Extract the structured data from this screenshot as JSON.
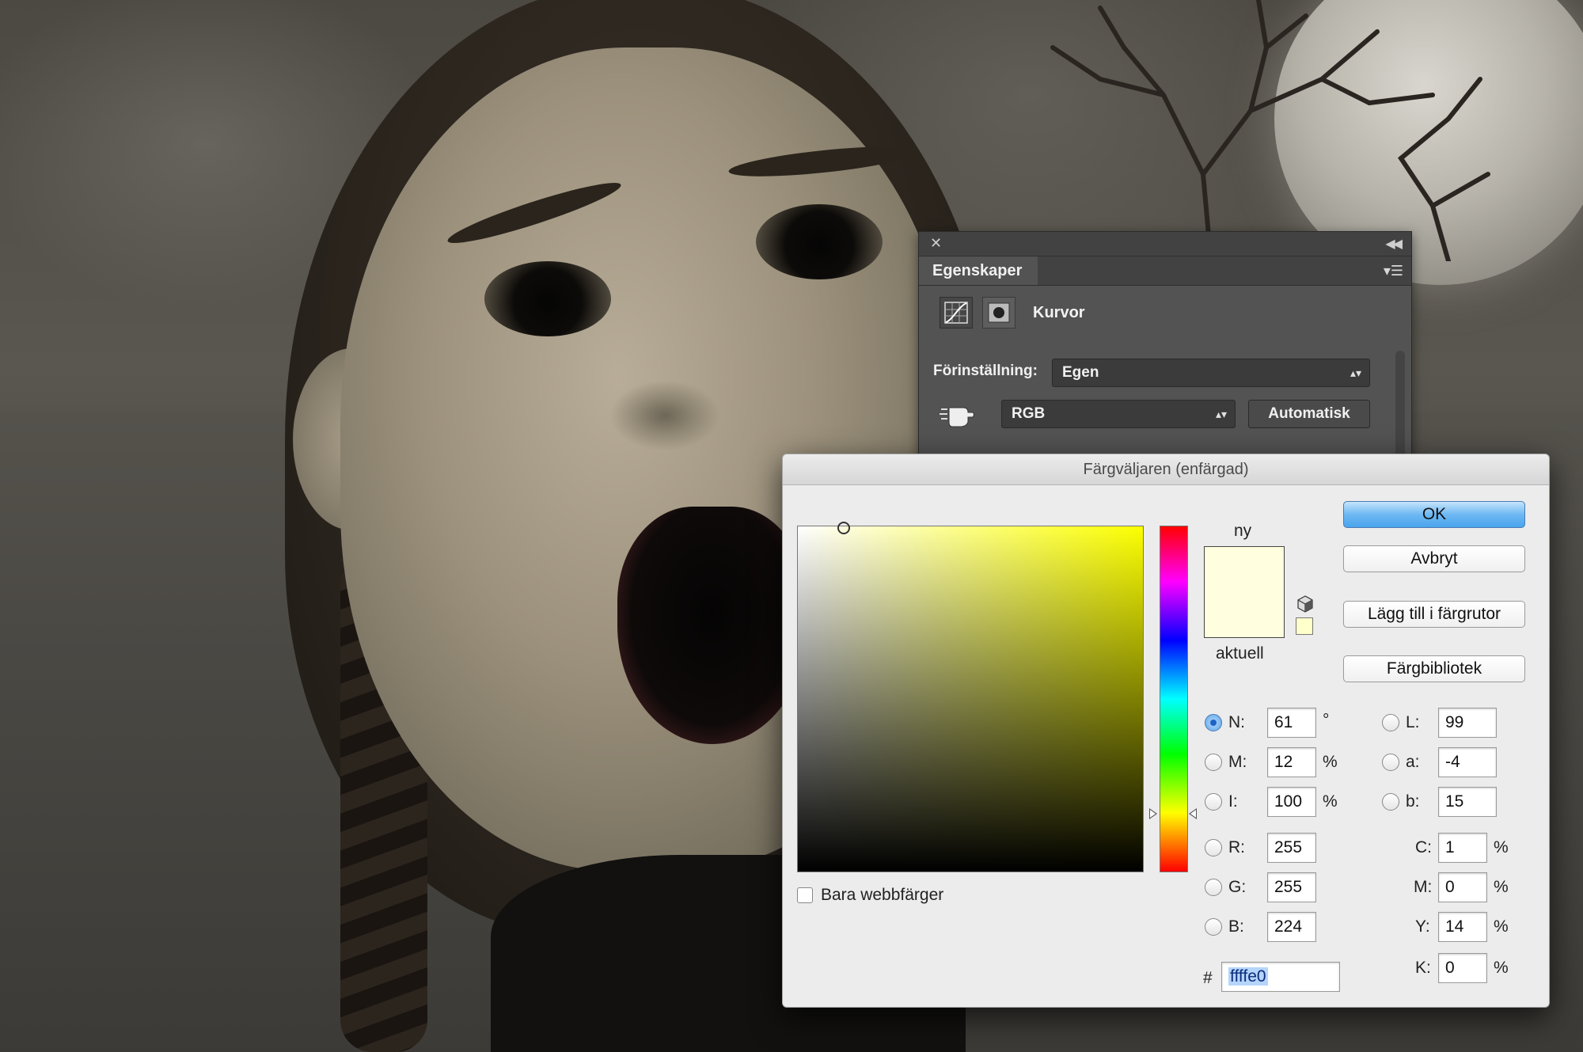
{
  "properties_panel": {
    "tab_label": "Egenskaper",
    "adjustment_title": "Kurvor",
    "preset_label": "Förinställning:",
    "preset_value": "Egen",
    "channel_value": "RGB",
    "auto_button": "Automatisk"
  },
  "color_picker": {
    "title": "Färgväljaren (enfärgad)",
    "buttons": {
      "ok": "OK",
      "cancel": "Avbryt",
      "add_swatches": "Lägg till i färgrutor",
      "color_libraries": "Färgbibliotek"
    },
    "new_label": "ny",
    "current_label": "aktuell",
    "web_only_label": "Bara webbfärger",
    "new_color": "#ffffe0",
    "current_color": "#ffffe0",
    "hsb": {
      "h": {
        "label": "N:",
        "value": "61",
        "unit": "°",
        "selected": true
      },
      "s": {
        "label": "M:",
        "value": "12",
        "unit": "%"
      },
      "b": {
        "label": "I:",
        "value": "100",
        "unit": "%"
      }
    },
    "rgb": {
      "r": {
        "label": "R:",
        "value": "255"
      },
      "g": {
        "label": "G:",
        "value": "255"
      },
      "b": {
        "label": "B:",
        "value": "224"
      }
    },
    "lab": {
      "l": {
        "label": "L:",
        "value": "99"
      },
      "a": {
        "label": "a:",
        "value": "-4"
      },
      "b": {
        "label": "b:",
        "value": "15"
      }
    },
    "cmyk": {
      "c": {
        "label": "C:",
        "value": "1",
        "unit": "%"
      },
      "m": {
        "label": "M:",
        "value": "0",
        "unit": "%"
      },
      "y": {
        "label": "Y:",
        "value": "14",
        "unit": "%"
      },
      "k": {
        "label": "K:",
        "value": "0",
        "unit": "%"
      }
    },
    "hex_label": "#",
    "hex_value": "ffffe0"
  }
}
